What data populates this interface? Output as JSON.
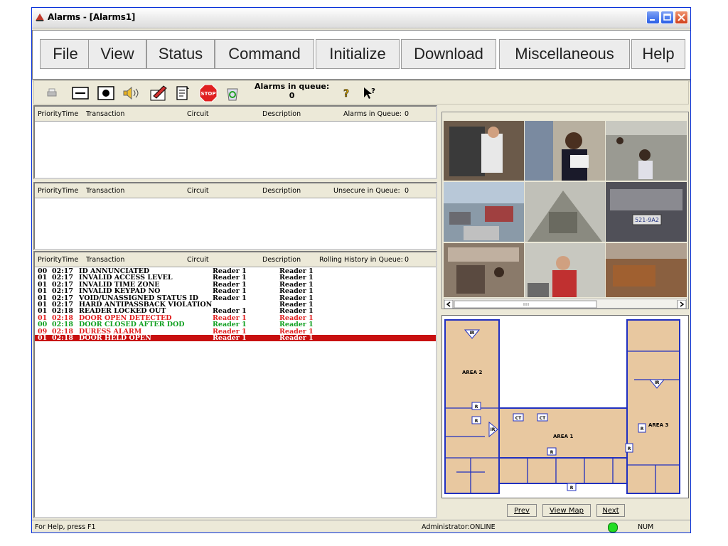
{
  "window": {
    "title": "Alarms - [Alarms1]"
  },
  "menu": [
    "File",
    "View",
    "Status",
    "Command",
    "Initialize",
    "Download",
    "Miscellaneous",
    "Help"
  ],
  "toolbar": {
    "queue_label": "Alarms in queue:",
    "queue_count": "0"
  },
  "columns": {
    "priority": "Priority",
    "time": "Time",
    "transaction": "Transaction",
    "circuit": "Circuit",
    "description": "Description"
  },
  "panes": {
    "alarms": {
      "queue_label": "Alarms in Queue:",
      "count": "0"
    },
    "unsecure": {
      "queue_label": "Unsecure in Queue:",
      "count": "0"
    },
    "history": {
      "queue_label": "Rolling History in Queue:",
      "count": "0",
      "rows": [
        {
          "p": "00",
          "t": "02:17",
          "tr": "ID ANNUNCIATED",
          "c": "Reader 1",
          "d": "Reader 1",
          "color": "#000000"
        },
        {
          "p": "01",
          "t": "02:17",
          "tr": "INVALID ACCESS LEVEL",
          "c": "Reader 1",
          "d": "Reader 1",
          "color": "#000000"
        },
        {
          "p": "01",
          "t": "02:17",
          "tr": "INVALID TIME ZONE",
          "c": "Reader 1",
          "d": "Reader 1",
          "color": "#000000"
        },
        {
          "p": "01",
          "t": "02:17",
          "tr": "INVALID KEYPAD NO",
          "c": "Reader 1",
          "d": "Reader 1",
          "color": "#000000"
        },
        {
          "p": "01",
          "t": "02:17",
          "tr": "VOID/UNASSIGNED STATUS ID",
          "c": "Reader 1",
          "d": "Reader 1",
          "color": "#000000"
        },
        {
          "p": "01",
          "t": "02:17",
          "tr": "HARD ANTIPASSBACK VIOLATION",
          "c": "",
          "d": "Reader 1",
          "color": "#000000"
        },
        {
          "p": "01",
          "t": "02:18",
          "tr": "READER LOCKED OUT",
          "c": "Reader 1",
          "d": "Reader 1",
          "color": "#000000"
        },
        {
          "p": "01",
          "t": "02:18",
          "tr": "DOOR OPEN DETECTED",
          "c": "Reader 1",
          "d": "Reader 1",
          "color": "#e02020"
        },
        {
          "p": "00",
          "t": "02:18",
          "tr": "DOOR CLOSED AFTER DOD",
          "c": "Reader 1",
          "d": "Reader 1",
          "color": "#10a020"
        },
        {
          "p": "09",
          "t": "02:18",
          "tr": "DURESS ALARM",
          "c": "Reader 1",
          "d": "Reader 1",
          "color": "#e02020"
        },
        {
          "p": "01",
          "t": "02:18",
          "tr": "DOOR HELD OPEN",
          "c": "Reader 1",
          "d": "Reader 1",
          "color": "#ffffff",
          "highlight": "#c81010"
        }
      ]
    }
  },
  "map": {
    "areas": [
      "AREA 2",
      "AREA 1",
      "AREA 3"
    ],
    "marker_ir": "IR",
    "marker_r": "R",
    "marker_ct": "CT",
    "nav": {
      "prev": "Prev",
      "view_map": "View Map",
      "next": "Next"
    }
  },
  "cameras": {
    "plate": "521-9A2"
  },
  "status": {
    "help": "For Help, press F1",
    "user": "Administrator:ONLINE",
    "num": "NUM",
    "led_color": "#22dd22"
  },
  "colors": {
    "title_blue": "#0831d9",
    "alarm_red": "#c81010",
    "ok_green": "#10a020",
    "map_fill": "#e8c8a0",
    "map_line": "#2030c0"
  }
}
